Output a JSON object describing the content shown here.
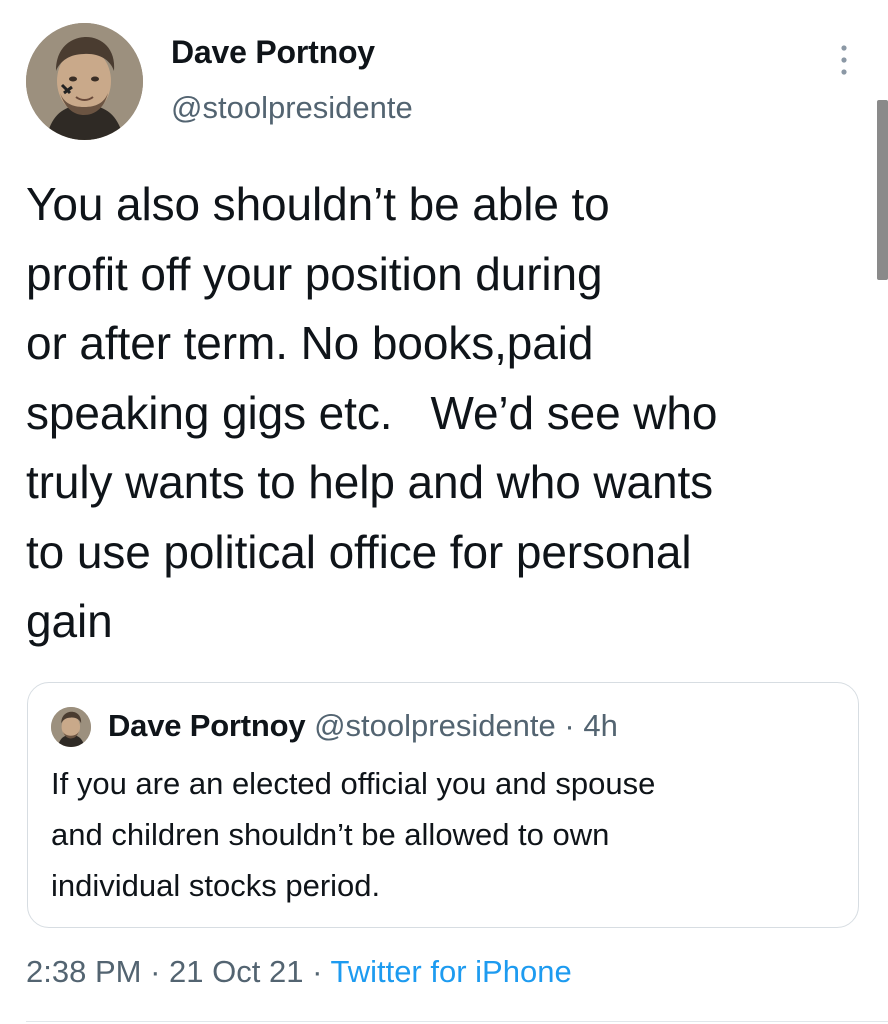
{
  "tweet": {
    "author_name": "Dave Portnoy",
    "author_handle": "@stoolpresidente",
    "more_icon": "more-vertical-icon",
    "text": "You also shouldn’t be able to\nprofit off your position during\nor after term. No books,paid\nspeaking gigs etc.   We’d see who\ntruly wants to help and who wants\nto use political office for personal\ngain",
    "time": "2:38 PM",
    "separator": "·",
    "date": "21 Oct 21",
    "source": "Twitter for iPhone"
  },
  "quoted_tweet": {
    "author_name": "Dave Portnoy",
    "author_handle": "@stoolpresidente",
    "separator": "·",
    "age": "4h",
    "text": "If you are an elected official you and spouse\nand children shouldn’t be allowed to own\nindividual stocks period."
  },
  "colors": {
    "text_primary": "#0f1419",
    "text_secondary": "#536471",
    "link": "#1d9bf0",
    "border": "#d7dde2"
  }
}
